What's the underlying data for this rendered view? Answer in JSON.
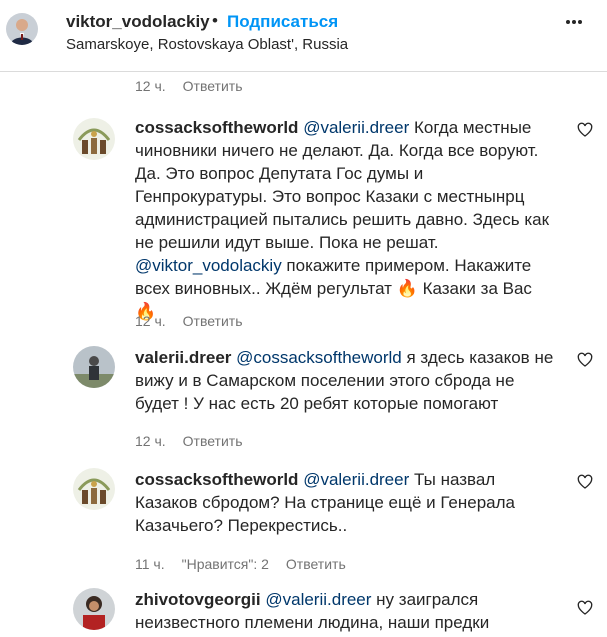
{
  "header": {
    "username": "viktor_vodolackiy",
    "separator": "•",
    "follow_label": "Подписаться",
    "location": "Samarskoye, Rostovskaya Oblast', Russia"
  },
  "top_meta": {
    "time": "12 ч.",
    "reply": "Ответить"
  },
  "comments": [
    {
      "username": "cossacksoftheworld",
      "mention": "@valerii.dreer",
      "text_a": " Когда местные чиновники ничего не делают. Да. Когда все воруют. Да. Это вопрос Депутата Гос думы и Генпрокуратуры. Это вопрос Казаки с местнынрц администрацией пытались решить давно. Здесь как не решили идут выше. Пока не решат. ",
      "mention_b": "@viktor_vodolackiy",
      "text_b": " покажите примером. Накажите всех виновных.. Ждём регультат ",
      "emoji_1": "🔥",
      "text_c": " Казаки за Вас ",
      "emoji_2": "🔥",
      "time": "12 ч.",
      "reply": "Ответить"
    },
    {
      "username": "valerii.dreer",
      "mention": "@cossacksoftheworld",
      "text_a": " я здесь казаков не вижу и в Самарском поселении этого сброда не будет ! У нас есть 20 ребят которые помогают",
      "time": "12 ч.",
      "reply": "Ответить"
    },
    {
      "username": "cossacksoftheworld",
      "mention": "@valerii.dreer",
      "text_a": " Ты назвал Казаков сбродом? На странице ещё и Генерала Казачьего? Перекрестись..",
      "time": "11 ч.",
      "likes": "\"Нравится\": 2",
      "reply": "Ответить"
    },
    {
      "username": "zhivotovgeorgii",
      "mention": "@valerii.dreer",
      "text_a": " ну заигрался неизвестного племени людина, наши предки"
    }
  ]
}
